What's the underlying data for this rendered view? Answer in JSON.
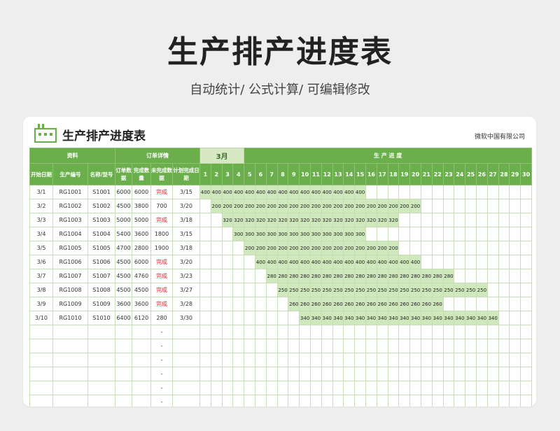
{
  "page": {
    "title": "生产排产进度表",
    "subtitle": "自动统计/ 公式计算/ 可编辑修改"
  },
  "card": {
    "title": "生产排产进度表",
    "company": "微软中国有限公司"
  },
  "table": {
    "group_headers": {
      "info": "资料",
      "order": "订单详情",
      "month": "3月",
      "progress": "生 产 进 度"
    },
    "columns": [
      "开始日期",
      "生产编号",
      "名称/型号",
      "订单数据",
      "完成数量",
      "未完成数据",
      "计划完成日期"
    ],
    "days": [
      1,
      2,
      3,
      4,
      5,
      6,
      7,
      8,
      9,
      10,
      11,
      12,
      13,
      14,
      15,
      16,
      17,
      18,
      19,
      20,
      21,
      22,
      23,
      24,
      25,
      26,
      27,
      28,
      29,
      30
    ],
    "rows": [
      {
        "start": "3/1",
        "code": "RG1001",
        "model": "S1001",
        "order": "6000",
        "done": "6000",
        "remain": "完成",
        "plan": "3/15",
        "value": "400",
        "from": 1,
        "to": 15
      },
      {
        "start": "3/2",
        "code": "RG1002",
        "model": "S1002",
        "order": "4500",
        "done": "3800",
        "remain": "700",
        "plan": "3/20",
        "value": "200",
        "from": 2,
        "to": 20
      },
      {
        "start": "3/3",
        "code": "RG1003",
        "model": "S1003",
        "order": "5000",
        "done": "5000",
        "remain": "完成",
        "plan": "3/18",
        "value": "320",
        "from": 3,
        "to": 18
      },
      {
        "start": "3/4",
        "code": "RG1004",
        "model": "S1004",
        "order": "5400",
        "done": "3600",
        "remain": "1800",
        "plan": "3/15",
        "value": "300",
        "from": 4,
        "to": 15
      },
      {
        "start": "3/5",
        "code": "RG1005",
        "model": "S1005",
        "order": "4700",
        "done": "2800",
        "remain": "1900",
        "plan": "3/18",
        "value": "200",
        "from": 5,
        "to": 18
      },
      {
        "start": "3/6",
        "code": "RG1006",
        "model": "S1006",
        "order": "4500",
        "done": "6000",
        "remain": "完成",
        "plan": "3/20",
        "value": "400",
        "from": 6,
        "to": 20
      },
      {
        "start": "3/7",
        "code": "RG1007",
        "model": "S1007",
        "order": "4500",
        "done": "4760",
        "remain": "完成",
        "plan": "3/23",
        "value": "280",
        "from": 7,
        "to": 23
      },
      {
        "start": "3/8",
        "code": "RG1008",
        "model": "S1008",
        "order": "4500",
        "done": "4500",
        "remain": "完成",
        "plan": "3/27",
        "value": "250",
        "from": 8,
        "to": 26
      },
      {
        "start": "3/9",
        "code": "RG1009",
        "model": "S1009",
        "order": "3600",
        "done": "3600",
        "remain": "完成",
        "plan": "3/28",
        "value": "260",
        "from": 9,
        "to": 22
      },
      {
        "start": "3/10",
        "code": "RG1010",
        "model": "S1010",
        "order": "6400",
        "done": "6120",
        "remain": "280",
        "plan": "3/30",
        "value": "340",
        "from": 10,
        "to": 27
      }
    ],
    "empty_rows": 6,
    "empty_remain": "-",
    "colors": {
      "header_green": "#6aaf4b",
      "bar_green": "#cfe8bc",
      "done_red": "#e03030"
    }
  }
}
